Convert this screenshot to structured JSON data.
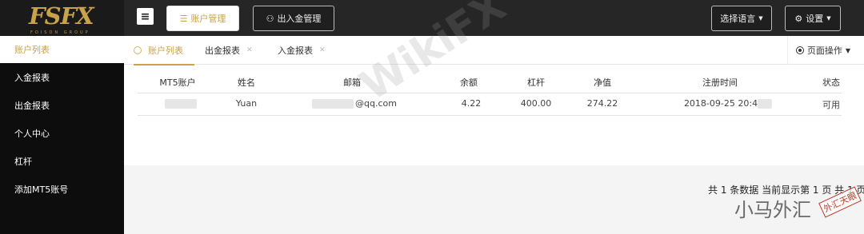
{
  "logo": {
    "main": "FSFX",
    "sub": "FOISON GROUP"
  },
  "topbar": {
    "menu_icon": "menu-icon",
    "account_btn": "账户管理",
    "funds_btn": "出入金管理",
    "language_btn": "选择语言",
    "settings_btn": "设置"
  },
  "sidebar": {
    "items": [
      {
        "label": "账户列表",
        "active": true
      },
      {
        "label": "入金报表",
        "active": false
      },
      {
        "label": "出金报表",
        "active": false
      },
      {
        "label": "个人中心",
        "active": false
      },
      {
        "label": "杠杆",
        "active": false
      },
      {
        "label": "添加MT5账号",
        "active": false
      }
    ]
  },
  "tabs": [
    {
      "label": "账户列表",
      "active": true
    },
    {
      "label": "出金报表",
      "active": false
    },
    {
      "label": "入金报表",
      "active": false
    }
  ],
  "page_ops": "页面操作",
  "table": {
    "headers": [
      "MT5账户",
      "姓名",
      "邮箱",
      "余额",
      "杠杆",
      "净值",
      "注册时间",
      "状态"
    ],
    "rows": [
      {
        "account": "",
        "name": "Yuan",
        "email": "@qq.com",
        "balance": "4.22",
        "leverage": "400.00",
        "equity": "274.22",
        "registered": "2018-09-25 20:4",
        "status": "可用"
      }
    ]
  },
  "footer": {
    "text": "共 1 条数据 当前显示第 1 页 共 1 页"
  },
  "watermark": {
    "brand": "WikiFX",
    "tag": "小马外汇",
    "stamp": "外汇天眼"
  },
  "colors": {
    "accent": "#c9a24a",
    "topbar": "#262626",
    "sidebar": "#0d0d0d"
  }
}
